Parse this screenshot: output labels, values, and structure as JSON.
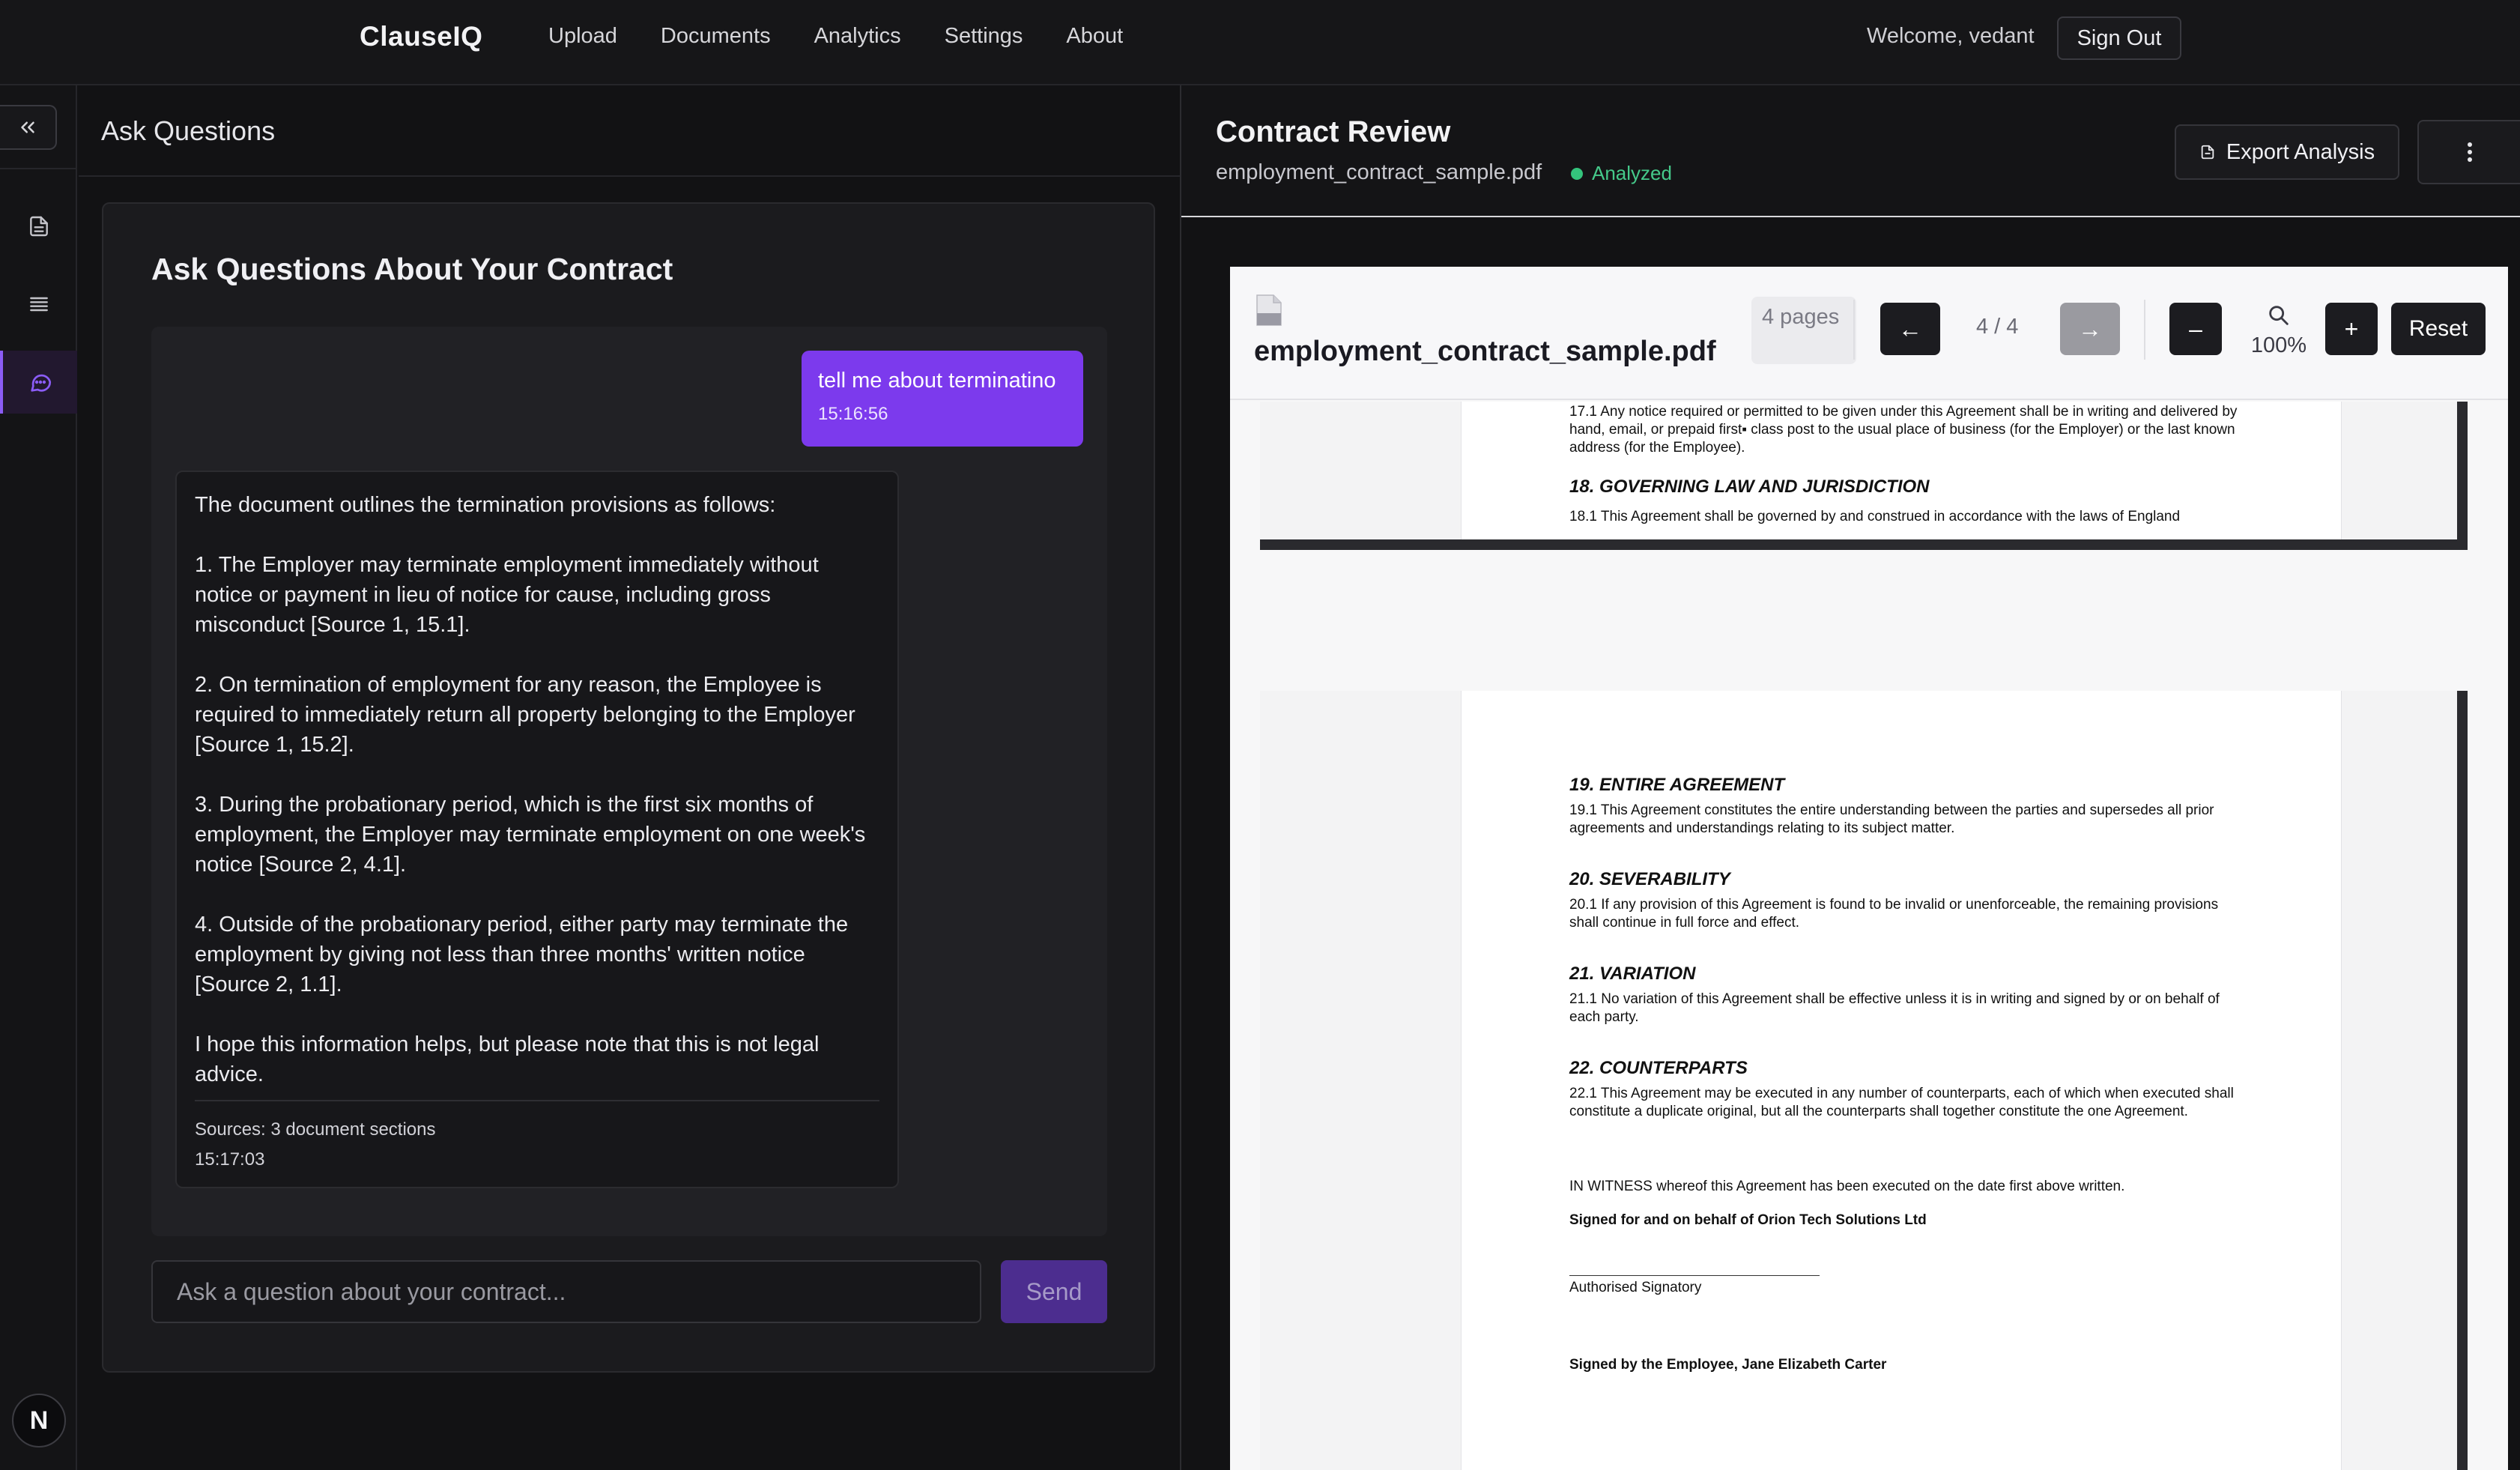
{
  "nav": {
    "brand": "ClauseIQ",
    "links": [
      "Upload",
      "Documents",
      "Analytics",
      "Settings",
      "About"
    ],
    "welcome": "Welcome, vedant",
    "signout": "Sign Out"
  },
  "sidebar": {
    "icons": [
      "collapse-icon",
      "document-icon",
      "list-icon",
      "chat-icon"
    ],
    "active": "chat-icon",
    "avatar_letter": "N"
  },
  "ask": {
    "header": "Ask Questions",
    "title": "Ask Questions About Your Contract",
    "user_message": "tell me about terminatino",
    "user_time": "15:16:56",
    "bot_message": "The document outlines the termination provisions as follows:\n\n1. The Employer may terminate employment immediately without notice or payment in lieu of notice for cause, including gross misconduct [Source 1, 15.1].\n\n2. On termination of employment for any reason, the Employee is required to immediately return all property belonging to the Employer [Source 1, 15.2].\n\n3. During the probationary period, which is the first six months of employment, the Employer may terminate employment on one week's notice [Source 2, 4.1].\n\n4. Outside of the probationary period, either party may terminate the employment by giving not less than three months' written notice [Source 2, 1.1].\n\nI hope this information helps, but please note that this is not legal advice.",
    "sources": "Sources: 3 document sections",
    "bot_time": "15:17:03",
    "input_placeholder": "Ask a question about your contract...",
    "send": "Send"
  },
  "review": {
    "title": "Contract Review",
    "file": "employment_contract_sample.pdf",
    "status": "Analyzed",
    "status_color": "#34c47c",
    "export": "Export Analysis"
  },
  "viewer": {
    "file": "employment_contract_sample.pdf",
    "pages_chip": "4 pages",
    "prev": "←",
    "next": "→",
    "page_indicator": "4 / 4",
    "zoom_out": "–",
    "zoom": "100%",
    "zoom_in": "+",
    "reset": "Reset"
  },
  "document": {
    "page3_tail": {
      "p17_1": "17.1 Any notice required or permitted to be given under this Agreement shall be in writing and delivered by hand, email, or prepaid first▪ class post to the usual place of business (for the Employer) or the last known address (for the Employee).",
      "h18": "18. GOVERNING LAW AND JURISDICTION",
      "p18_1": "18.1 This Agreement shall be governed by and construed in accordance with the laws of England"
    },
    "page4": {
      "h19": "19. ENTIRE AGREEMENT",
      "p19_1": "19.1 This Agreement constitutes the entire understanding between the parties and supersedes all prior agreements and understandings relating to its subject matter.",
      "h20": "20. SEVERABILITY",
      "p20_1": "20.1 If any provision of this Agreement is found to be invalid or unenforceable, the remaining provisions shall continue in full force and effect.",
      "h21": "21. VARIATION",
      "p21_1": "21.1 No variation of this Agreement shall be effective unless it is in writing and signed by or on behalf of each party.",
      "h22": "22. COUNTERPARTS",
      "p22_1": "22.1 This Agreement may be executed in any number of counterparts, each of which when executed shall constitute a duplicate original, but all the counterparts shall together constitute the one Agreement.",
      "witness": "IN WITNESS whereof this Agreement has been executed on the date first above written.",
      "signed_employer": "Signed for and on behalf of Orion Tech Solutions Ltd",
      "authorised": "Authorised Signatory",
      "signed_employee": "Signed by the Employee, Jane Elizabeth Carter"
    }
  }
}
